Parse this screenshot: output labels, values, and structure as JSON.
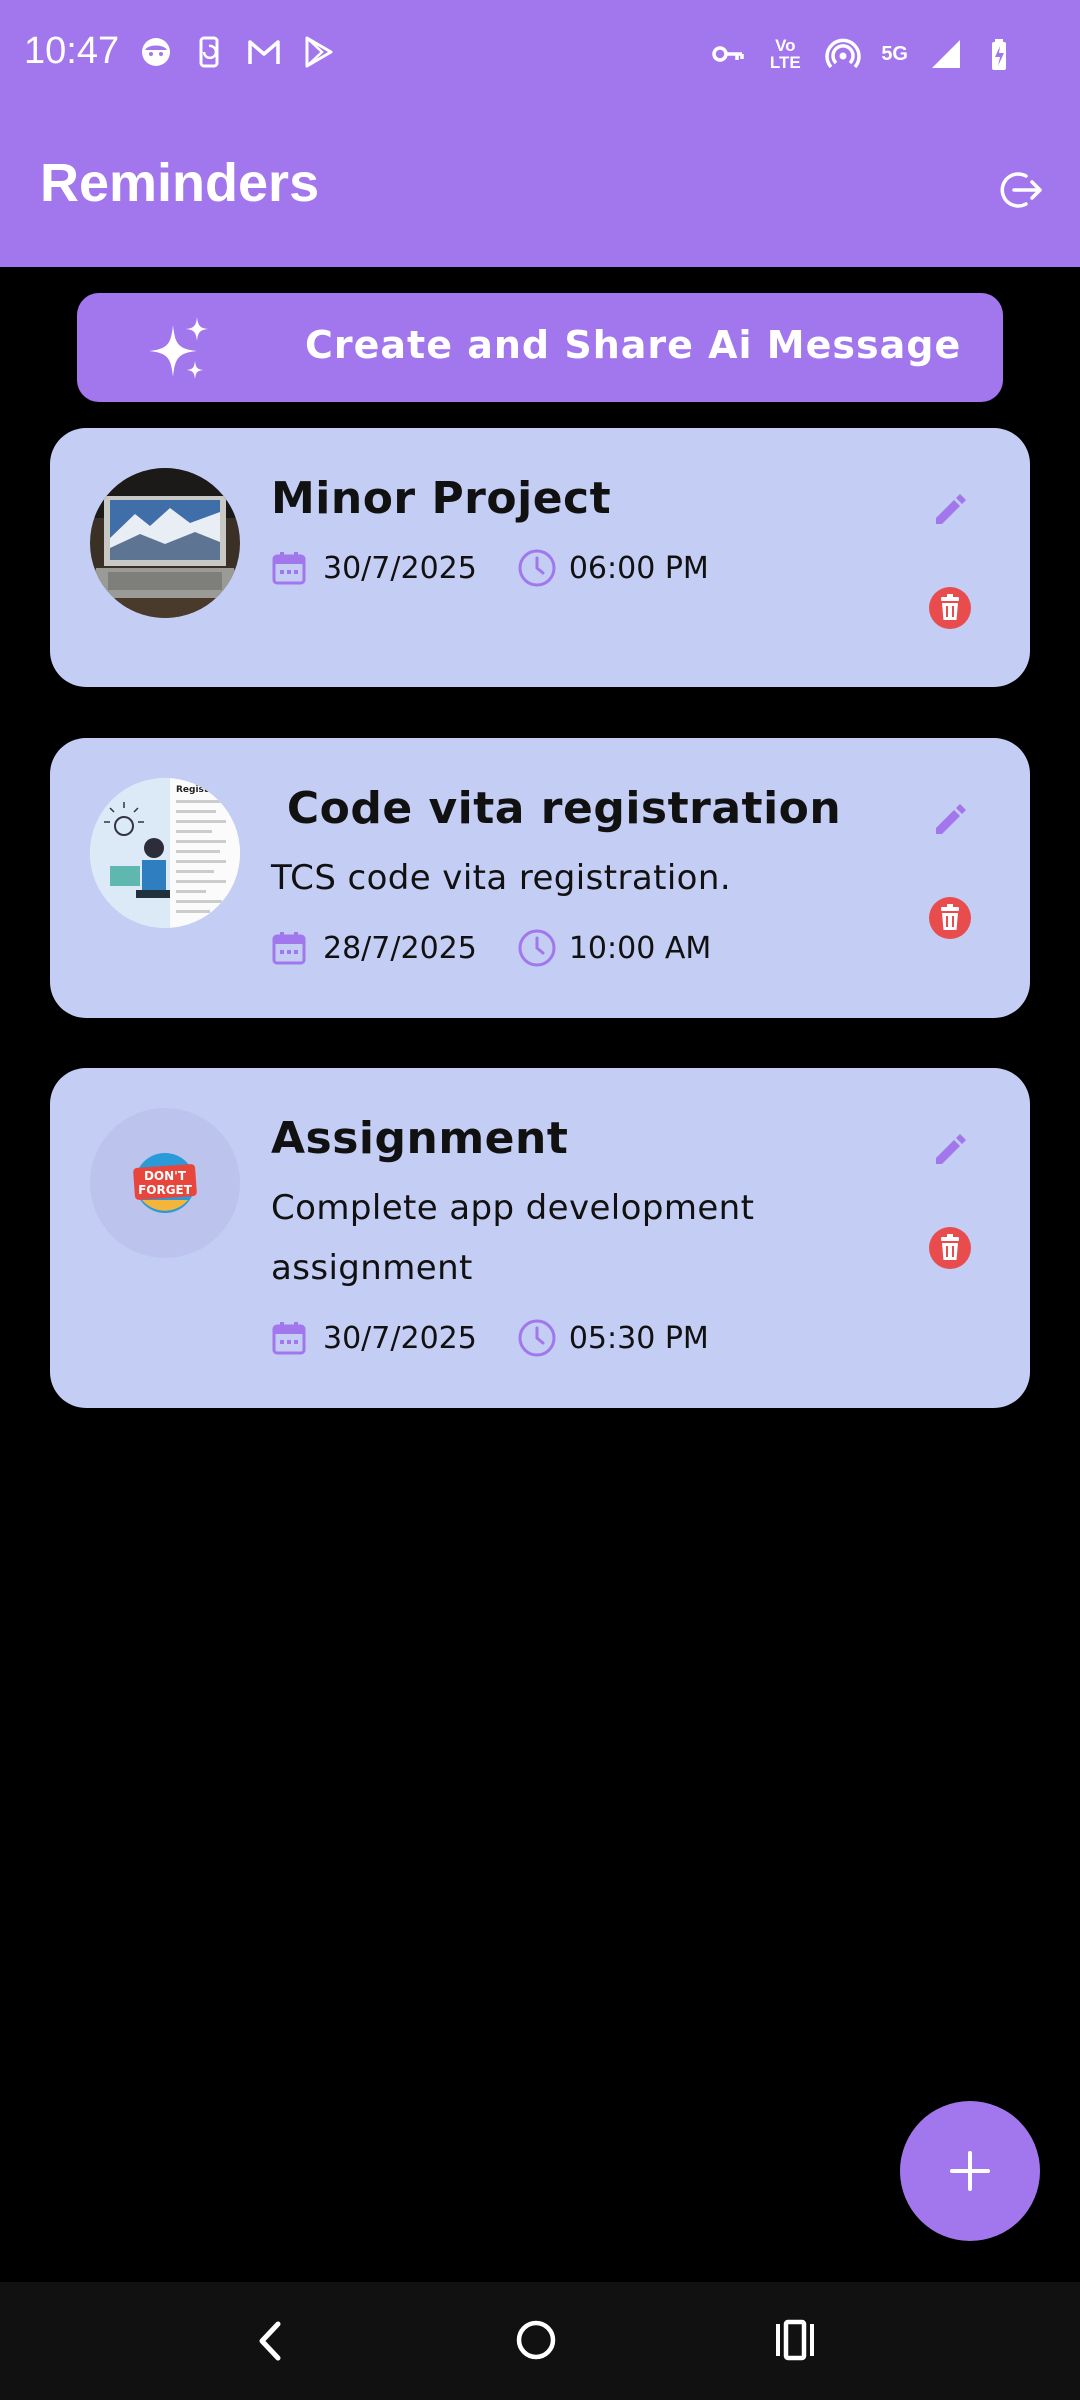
{
  "status_bar": {
    "time": "10:47",
    "volte_top": "Vo",
    "volte_bottom": "LTE",
    "network": "5G",
    "left_icons": [
      "face-icon",
      "phone-sync-icon",
      "gmail-icon",
      "play-store-icon"
    ],
    "right_icons": [
      "vpn-key-icon",
      "volte-icon",
      "hotspot-icon",
      "5g-icon",
      "signal-icon",
      "battery-charging-icon"
    ]
  },
  "app_bar": {
    "title": "Reminders",
    "logout_icon": "logout-icon"
  },
  "ai_button": {
    "label": "Create and Share Ai Message",
    "icon": "sparkle-icon"
  },
  "reminders": [
    {
      "title": "Minor Project",
      "description": "",
      "date": "30/7/2025",
      "time": "06:00 PM",
      "image": "laptop-photo"
    },
    {
      "title": " Code vita registration",
      "description": "TCS code vita registration.",
      "date": "28/7/2025",
      "time": "10:00 AM",
      "image": "registration-illustration"
    },
    {
      "title": "Assignment",
      "description": "Complete app development assignment",
      "date": "30/7/2025",
      "time": "05:30 PM",
      "image": "dont-forget-sticker",
      "image_text_1": "DON'T",
      "image_text_2": "FORGET"
    }
  ],
  "fab": {
    "icon": "plus-icon"
  },
  "colors": {
    "primary": "#a276ec",
    "card_background": "#c4cdf4",
    "delete_red": "#e84c4c",
    "background": "#000000"
  }
}
